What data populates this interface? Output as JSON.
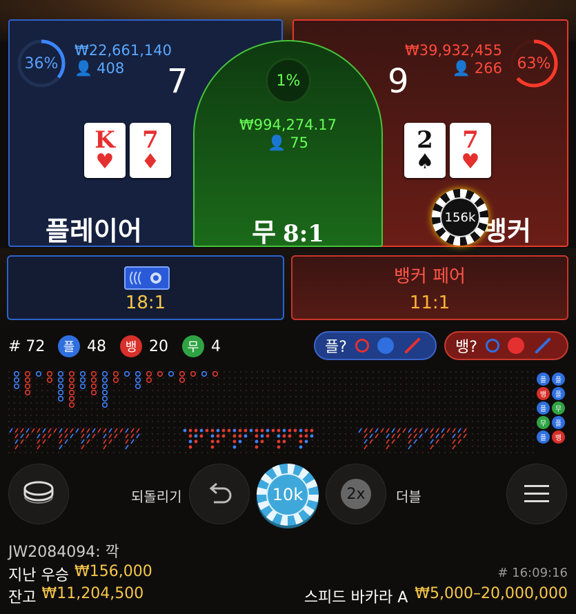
{
  "player": {
    "percent": "36%",
    "amount": "₩22,661,140",
    "players": "408",
    "score": "7",
    "cards": [
      {
        "rank": "K",
        "suit": "♥",
        "color": "red"
      },
      {
        "rank": "7",
        "suit": "♦",
        "color": "red"
      }
    ],
    "label": "플레이어"
  },
  "tie": {
    "percent": "1%",
    "amount": "₩994,274.17",
    "players": "75",
    "label": "무",
    "payout": "8:1"
  },
  "banker": {
    "percent": "63%",
    "amount": "₩39,932,455",
    "players": "266",
    "score": "9",
    "cards": [
      {
        "rank": "2",
        "suit": "♠",
        "color": "black"
      },
      {
        "rank": "7",
        "suit": "♥",
        "color": "red"
      }
    ],
    "label": "뱅커",
    "chip": "156k"
  },
  "player_pair": {
    "payout": "18:1"
  },
  "banker_pair": {
    "label": "뱅커 페어",
    "payout": "11:1"
  },
  "stats": {
    "round": "# 72",
    "player_badge": "플",
    "player_count": "48",
    "banker_badge": "뱅",
    "banker_count": "20",
    "tie_badge": "무",
    "tie_count": "4"
  },
  "predict": {
    "player_label": "플?",
    "banker_label": "뱅?"
  },
  "side_legend": [
    "플",
    "플",
    "뱅",
    "플",
    "플",
    "무",
    "무",
    "플",
    "플",
    "뱅"
  ],
  "controls": {
    "undo_label": "되돌리기",
    "chip": "10k",
    "double_chip": "2x",
    "double_label": "더블"
  },
  "footer": {
    "user": "JW2084094: 깍",
    "last_win_label": "지난 우승",
    "last_win_value": "₩156,000",
    "balance_label": "잔고",
    "balance_value": "₩11,204,500",
    "time": "# 16:09:16",
    "table_name": "스피드 바카라 A",
    "limits": "₩5,000–20,000,000"
  },
  "colors": {
    "player": "#2e63c9",
    "banker": "#e43a2b",
    "tie": "#47c43a",
    "gold": "#f6c74a"
  }
}
